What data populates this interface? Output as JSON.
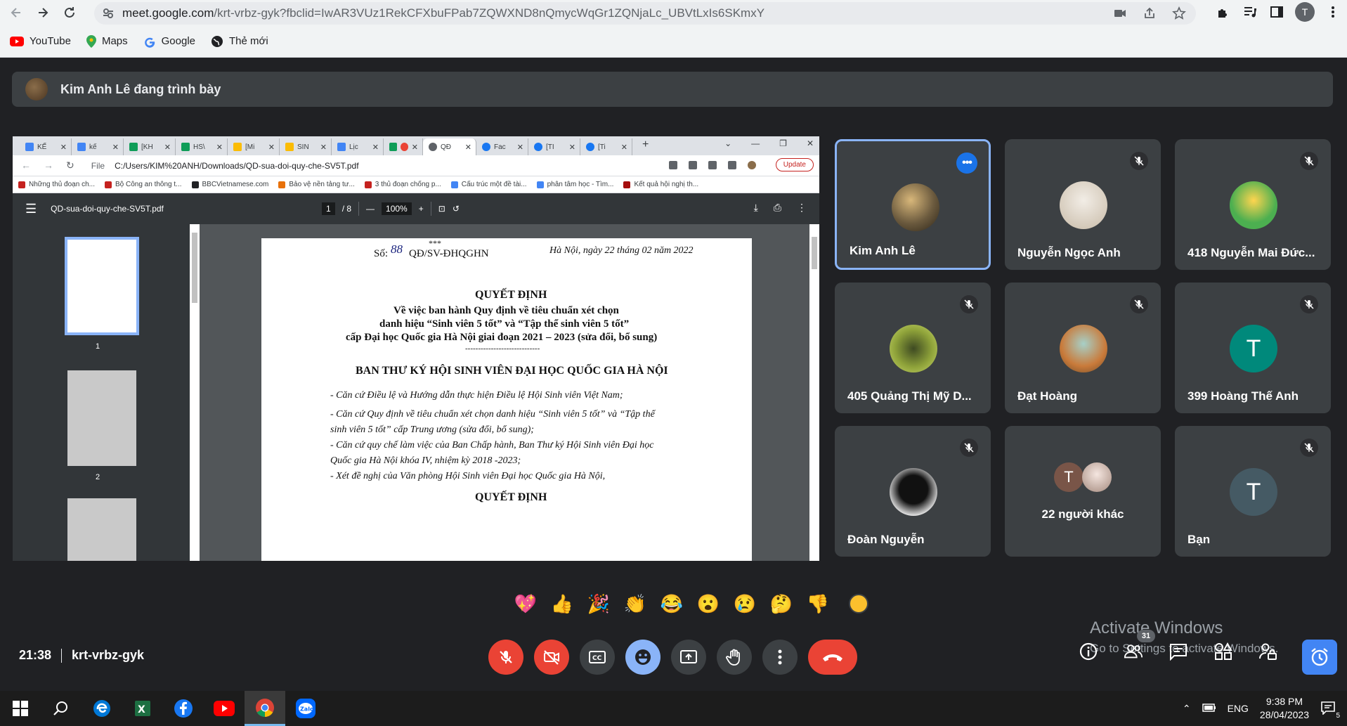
{
  "browser": {
    "url_host": "meet.google.com",
    "url_path": "/krt-vrbz-gyk?fbclid=IwAR3VUz1RekCFXbuFPab7ZQWXND8nQmycWqGr1ZQNjaLc_UBVtLxIs6SKmxY",
    "profile_initial": "T",
    "bookmarks": [
      {
        "label": "YouTube",
        "color": "#ff0000"
      },
      {
        "label": "Maps",
        "color": "#34a853"
      },
      {
        "label": "Google",
        "color": "#4285f4"
      },
      {
        "label": "Thẻ mới",
        "color": "#202124"
      }
    ]
  },
  "presenter_banner": {
    "text": "Kim Anh Lê đang trình bày"
  },
  "shared_screen": {
    "tabs": [
      {
        "label": "KẾ",
        "color": "#4285f4"
      },
      {
        "label": "kế",
        "color": "#4285f4"
      },
      {
        "label": "[KH",
        "color": "#0f9d58"
      },
      {
        "label": "HS\\",
        "color": "#0f9d58"
      },
      {
        "label": "[Mi",
        "color": "#fbbc04"
      },
      {
        "label": "SIN",
        "color": "#fbbc04"
      },
      {
        "label": "Lịc",
        "color": "#4285f4"
      },
      {
        "label": "",
        "color": "#ea4335"
      },
      {
        "label": "QĐ",
        "color": "#5f6368"
      },
      {
        "label": "Fac",
        "color": "#1877f2"
      },
      {
        "label": "[TI",
        "color": "#1877f2"
      },
      {
        "label": "[Ti",
        "color": "#1877f2"
      }
    ],
    "file_label": "File",
    "path": "C:/Users/KIM%20ANH/Downloads/QD-sua-doi-quy-che-SV5T.pdf",
    "update_label": "Update",
    "bookmarks": [
      {
        "label": "Những thủ đoạn ch...",
        "color": "#c5221f"
      },
      {
        "label": "Bộ Công an thông t...",
        "color": "#c5221f"
      },
      {
        "label": "BBCVietnamese.com",
        "color": "#202124"
      },
      {
        "label": "Bảo vệ nền tảng tư...",
        "color": "#e8710a"
      },
      {
        "label": "3 thủ đoạn chống p...",
        "color": "#c5221f"
      },
      {
        "label": "Cấu trúc một đề tài...",
        "color": "#4285f4"
      },
      {
        "label": "phân tâm học - Tìm...",
        "color": "#4285f4"
      },
      {
        "label": "Kết quả hội nghị th...",
        "color": "#a50e0e"
      }
    ],
    "pdf": {
      "filename": "QD-sua-doi-quy-che-SV5T.pdf",
      "page_current": "1",
      "page_total": "/ 8",
      "zoom": "100%",
      "thumb_labels": [
        "1",
        "2"
      ],
      "page_text": {
        "stars": "***",
        "number": "Số:",
        "number_hand": "88",
        "number_suffix": "QĐ/SV-ĐHQGHN",
        "date": "Hà Nội, ngày 22 tháng 02 năm 2022",
        "heading": "QUYẾT ĐỊNH",
        "subject1": "Về việc ban hành Quy định về tiêu chuẩn xét chọn",
        "subject2": "danh hiệu “Sinh viên 5 tốt” và “Tập thể sinh viên 5 tốt”",
        "subject3": "cấp Đại học Quốc gia Hà Nội giai đoạn 2021 – 2023 (sửa đổi, bổ sung)",
        "rule": "-----------------------------",
        "body_title": "BAN THƯ KÝ HỘI SINH VIÊN ĐẠI HỌC QUỐC GIA HÀ NỘI",
        "p1": "- Căn cứ Điều lệ và Hướng dẫn thực hiện Điều lệ Hội Sinh viên Việt Nam;",
        "p2a": "- Căn cứ Quy định về tiêu chuẩn xét chọn danh hiệu “Sinh viên 5 tốt” và “Tập thể",
        "p2b": "sinh viên 5 tốt” cấp Trung ương (sửa đổi, bổ sung);",
        "p3a": "- Căn cứ quy chế làm việc của Ban Chấp hành, Ban Thư ký Hội Sinh viên Đại học",
        "p3b": "Quốc gia Hà Nội khóa IV, nhiệm kỳ 2018 -2023;",
        "p4": "- Xét đề nghị của Văn phòng Hội Sinh viên Đại học Quốc gia Hà Nội,",
        "heading2": "QUYẾT ĐỊNH"
      }
    }
  },
  "participants": [
    {
      "name": "Kim Anh Lê",
      "speaking": true,
      "muted": false,
      "avatar": "photo-sparkle",
      "color": "#6b5a3e"
    },
    {
      "name": "Nguyễn Ngọc Anh",
      "speaking": false,
      "muted": true,
      "avatar": "photo-person",
      "color": "#d9d2c8"
    },
    {
      "name": "418 Nguyễn Mai Đức...",
      "speaking": false,
      "muted": true,
      "avatar": "photo-cartoon",
      "color": "#4caf50"
    },
    {
      "name": "405 Quảng Thị Mỹ D...",
      "speaking": false,
      "muted": true,
      "avatar": "photo-nature",
      "color": "#7a8f2e"
    },
    {
      "name": "Đạt Hoàng",
      "speaking": false,
      "muted": true,
      "avatar": "photo-tree",
      "color": "#c97a3a"
    },
    {
      "name": "399 Hoàng Thế Anh",
      "speaking": false,
      "muted": true,
      "avatar": "T",
      "color": "#00897b"
    },
    {
      "name": "Đoàn Nguyễn",
      "speaking": false,
      "muted": true,
      "avatar": "photo-dark",
      "color": "#eeeeee"
    },
    {
      "name": "22 người khác",
      "speaking": false,
      "muted": false,
      "avatar": "group",
      "color": "#795548"
    },
    {
      "name": "Bạn",
      "speaking": false,
      "muted": true,
      "avatar": "T",
      "color": "#455a64"
    }
  ],
  "group_avatar_initial": "T",
  "reactions": [
    "💖",
    "👍",
    "🎉",
    "👏",
    "😂",
    "😮",
    "😢",
    "🤔",
    "👎"
  ],
  "meeting": {
    "time": "21:38",
    "code": "krt-vrbz-gyk"
  },
  "people_count": "31",
  "watermark": {
    "title": "Activate Windows",
    "subtitle": "Go to Settings to activate Windows."
  },
  "taskbar": {
    "lang": "ENG",
    "time": "9:38 PM",
    "date": "28/04/2023",
    "notif_count": "5"
  }
}
